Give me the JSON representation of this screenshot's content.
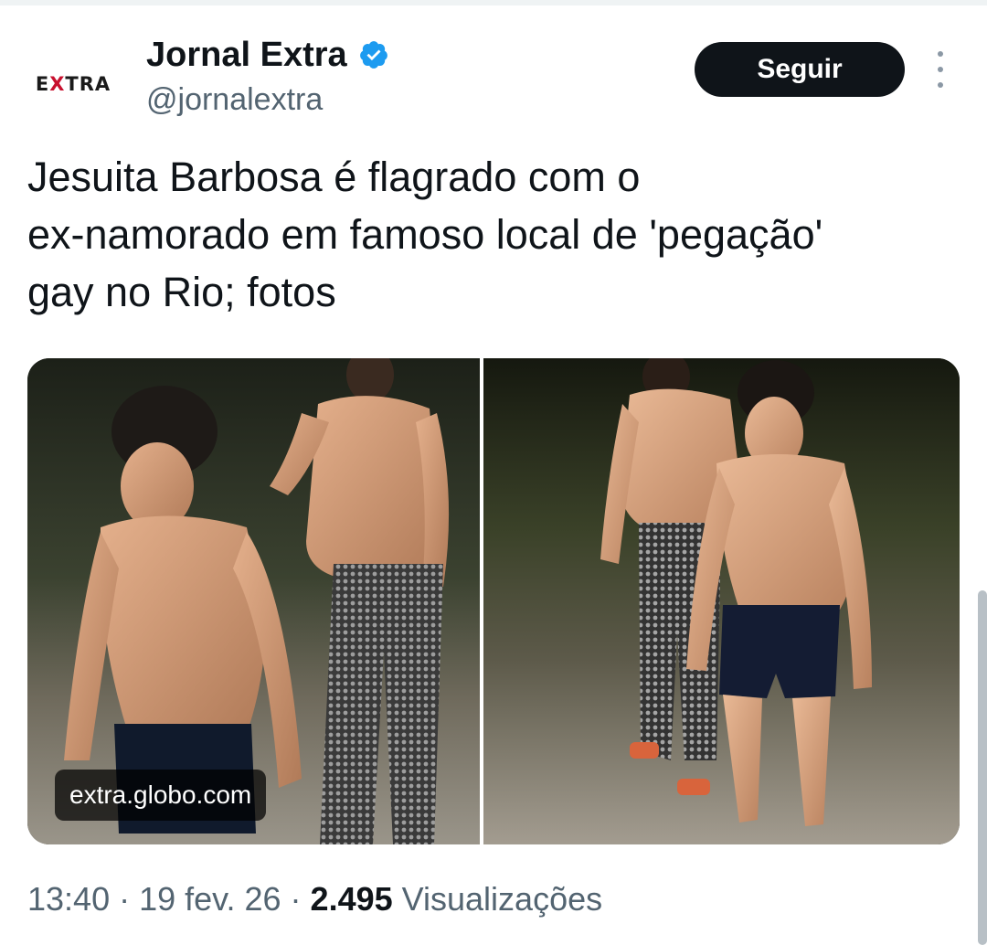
{
  "account": {
    "logo_text_left": "E",
    "logo_text_x": "X",
    "logo_text_right": "TRA",
    "display_name": "Jornal Extra",
    "handle": "@jornalextra",
    "verified": true,
    "verified_icon": "verified-badge-icon",
    "verified_color": "#1d9bf0"
  },
  "actions": {
    "follow_label": "Seguir",
    "more_icon": "more-vertical-icon"
  },
  "tweet": {
    "text": "Jesuita Barbosa é flagrado com o\nex-namorado em famoso local de 'pegação'\ngay no Rio; fotos"
  },
  "media": {
    "photo_count": 2,
    "source_label": "extra.globo.com"
  },
  "meta": {
    "time": "13:40",
    "sep1": " · ",
    "date": "19 fev. 26",
    "sep2": " · ",
    "views_count": "2.495",
    "views_label": " Visualizações"
  },
  "colors": {
    "brand_red": "#c8102e",
    "button_bg": "#0f1419",
    "secondary_text": "#536471"
  }
}
